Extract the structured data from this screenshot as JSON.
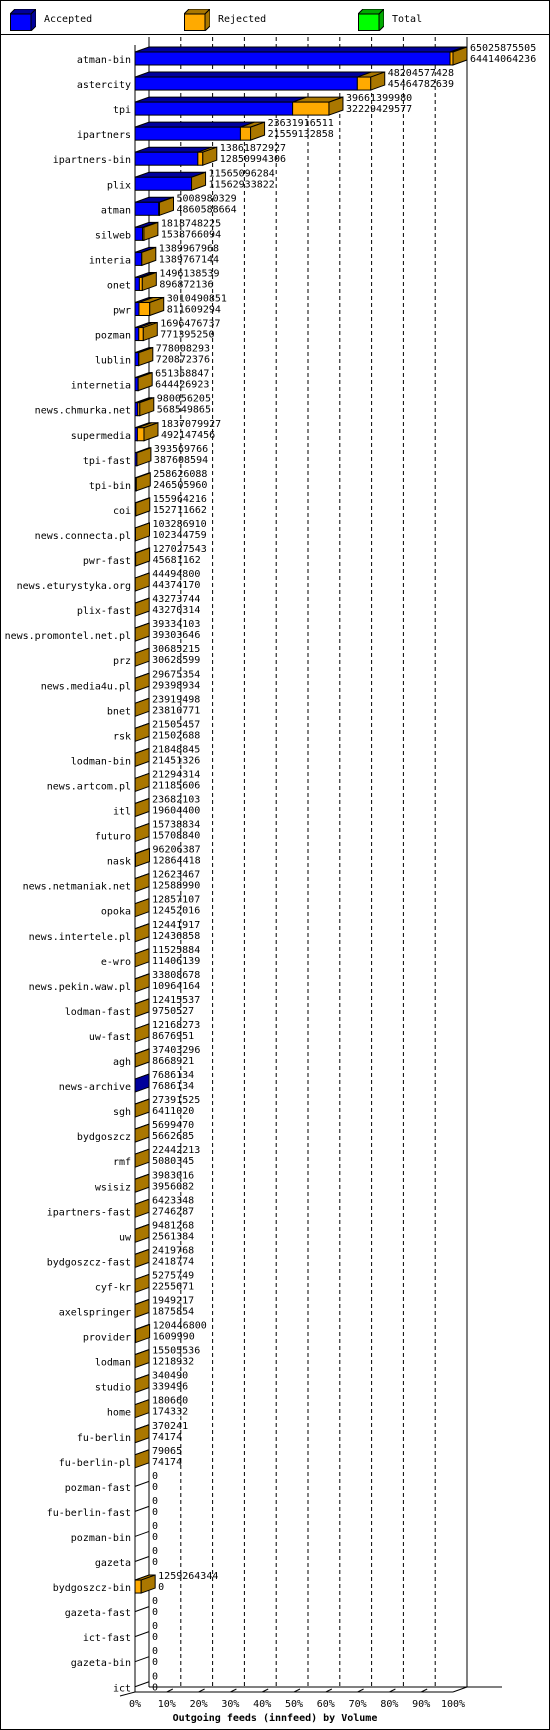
{
  "legend": {
    "position": "top",
    "items": [
      {
        "label": "Accepted",
        "color": "#0000ff",
        "side": "#00009c"
      },
      {
        "label": "Rejected",
        "color": "#ffaa00",
        "side": "#aa7700"
      },
      {
        "label": "Total",
        "color": "#00ff00",
        "side": "#00aa00"
      }
    ]
  },
  "chart_data": {
    "type": "bar",
    "orientation": "horizontal",
    "style": "3d-stacked",
    "title": "Outgoing feeds (innfeed) by Volume",
    "xlabel": "Outgoing feeds (innfeed) by Volume",
    "ylabel": "",
    "xlim": [
      0,
      100
    ],
    "x_unit": "% of maximum total",
    "x_ticks": [
      "0%",
      "10%",
      "20%",
      "30%",
      "40%",
      "50%",
      "60%",
      "70%",
      "80%",
      "90%",
      "100%"
    ],
    "grid": true,
    "legend_placement": "top",
    "series_colors": {
      "accepted": "#0000ff",
      "rejected": "#ffaa00",
      "total": "#aa7700"
    },
    "max_total": 65025875505,
    "categories": [
      {
        "name": "atman-bin",
        "total": 65025875505,
        "accepted": 64414064236
      },
      {
        "name": "astercity",
        "total": 48204577428,
        "accepted": 45464782639
      },
      {
        "name": "tpi",
        "total": 39661399980,
        "accepted": 32229429577
      },
      {
        "name": "ipartners",
        "total": 23631916511,
        "accepted": 21559132858
      },
      {
        "name": "ipartners-bin",
        "total": 13861872927,
        "accepted": 12850994306
      },
      {
        "name": "plix",
        "total": 11565096284,
        "accepted": 11562933822
      },
      {
        "name": "atman",
        "total": 5008980329,
        "accepted": 4860588664
      },
      {
        "name": "silweb",
        "total": 1818748225,
        "accepted": 1538766094
      },
      {
        "name": "interia",
        "total": 1389967968,
        "accepted": 1389767144
      },
      {
        "name": "onet",
        "total": 1496138539,
        "accepted": 896872136
      },
      {
        "name": "pwr",
        "total": 3010490851,
        "accepted": 811609294
      },
      {
        "name": "pozman",
        "total": 1696476737,
        "accepted": 771395250
      },
      {
        "name": "lublin",
        "total": 778008293,
        "accepted": 720872376
      },
      {
        "name": "internetia",
        "total": 651358847,
        "accepted": 644426923
      },
      {
        "name": "news.chmurka.net",
        "total": 980056205,
        "accepted": 568549865
      },
      {
        "name": "supermedia",
        "total": 1837079927,
        "accepted": 492147456
      },
      {
        "name": "tpi-fast",
        "total": 393569766,
        "accepted": 387608594
      },
      {
        "name": "tpi-bin",
        "total": 258626088,
        "accepted": 246505960
      },
      {
        "name": "coi",
        "total": 155964216,
        "accepted": 152711662
      },
      {
        "name": "news.connecta.pl",
        "total": 103286910,
        "accepted": 102344759
      },
      {
        "name": "pwr-fast",
        "total": 127027543,
        "accepted": 45681162
      },
      {
        "name": "news.eturystyka.org",
        "total": 44494800,
        "accepted": 44374170
      },
      {
        "name": "plix-fast",
        "total": 43273744,
        "accepted": 43270314
      },
      {
        "name": "news.promontel.net.pl",
        "total": 39334103,
        "accepted": 39303646
      },
      {
        "name": "prz",
        "total": 30685215,
        "accepted": 30628599
      },
      {
        "name": "news.media4u.pl",
        "total": 29675354,
        "accepted": 29398934
      },
      {
        "name": "bnet",
        "total": 23919498,
        "accepted": 23810771
      },
      {
        "name": "rsk",
        "total": 21505457,
        "accepted": 21502688
      },
      {
        "name": "lodman-bin",
        "total": 21848845,
        "accepted": 21451326
      },
      {
        "name": "news.artcom.pl",
        "total": 21294314,
        "accepted": 21185606
      },
      {
        "name": "itl",
        "total": 23682103,
        "accepted": 19604400
      },
      {
        "name": "futuro",
        "total": 15738834,
        "accepted": 15708840
      },
      {
        "name": "nask",
        "total": 96206387,
        "accepted": 12864418
      },
      {
        "name": "news.netmaniak.net",
        "total": 12623467,
        "accepted": 12588990
      },
      {
        "name": "opoka",
        "total": 12857107,
        "accepted": 12452016
      },
      {
        "name": "news.intertele.pl",
        "total": 12441917,
        "accepted": 12436858
      },
      {
        "name": "e-wro",
        "total": 11525884,
        "accepted": 11406139
      },
      {
        "name": "news.pekin.waw.pl",
        "total": 33808678,
        "accepted": 10964164
      },
      {
        "name": "lodman-fast",
        "total": 12415537,
        "accepted": 9750527
      },
      {
        "name": "uw-fast",
        "total": 12168273,
        "accepted": 8676951
      },
      {
        "name": "agh",
        "total": 37403296,
        "accepted": 8668921
      },
      {
        "name": "news-archive",
        "total": 7686134,
        "accepted": 7686134
      },
      {
        "name": "sgh",
        "total": 27391525,
        "accepted": 6411020
      },
      {
        "name": "bydgoszcz",
        "total": 5699470,
        "accepted": 5662685
      },
      {
        "name": "rmf",
        "total": 22442213,
        "accepted": 5080345
      },
      {
        "name": "wsisiz",
        "total": 3983016,
        "accepted": 3956082
      },
      {
        "name": "ipartners-fast",
        "total": 6423348,
        "accepted": 2746287
      },
      {
        "name": "uw",
        "total": 9481268,
        "accepted": 2561384
      },
      {
        "name": "bydgoszcz-fast",
        "total": 2419768,
        "accepted": 2418774
      },
      {
        "name": "cyf-kr",
        "total": 5275749,
        "accepted": 2255671
      },
      {
        "name": "axelspringer",
        "total": 1949217,
        "accepted": 1875854
      },
      {
        "name": "provider",
        "total": 120446800,
        "accepted": 1609990
      },
      {
        "name": "lodman",
        "total": 15505536,
        "accepted": 1218932
      },
      {
        "name": "studio",
        "total": 340490,
        "accepted": 339496
      },
      {
        "name": "home",
        "total": 180660,
        "accepted": 174332
      },
      {
        "name": "fu-berlin",
        "total": 370241,
        "accepted": 74174
      },
      {
        "name": "fu-berlin-pl",
        "total": 79065,
        "accepted": 74174
      },
      {
        "name": "pozman-fast",
        "total": 0,
        "accepted": 0
      },
      {
        "name": "fu-berlin-fast",
        "total": 0,
        "accepted": 0
      },
      {
        "name": "pozman-bin",
        "total": 0,
        "accepted": 0
      },
      {
        "name": "gazeta",
        "total": 0,
        "accepted": 0
      },
      {
        "name": "bydgoszcz-bin",
        "total": 1259264344,
        "accepted": 0
      },
      {
        "name": "gazeta-fast",
        "total": 0,
        "accepted": 0
      },
      {
        "name": "ict-fast",
        "total": 0,
        "accepted": 0
      },
      {
        "name": "gazeta-bin",
        "total": 0,
        "accepted": 0
      },
      {
        "name": "ict",
        "total": 0,
        "accepted": 0
      }
    ]
  }
}
